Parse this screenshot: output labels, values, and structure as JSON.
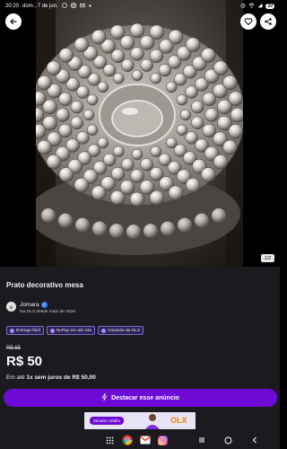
{
  "status_bar": {
    "time": "20:20",
    "date": "dom., 7 de jun.",
    "battery": "20",
    "icons": [
      "whatsapp-icon",
      "instagram-icon",
      "gmail-icon",
      "notification-dot-icon",
      "alarm-icon",
      "wifi-icon",
      "signal-icon"
    ]
  },
  "gallery": {
    "counter": "1/2",
    "subject": "glass-hobnail-plate-photo"
  },
  "header_actions": {
    "back_icon": "arrow-left-icon",
    "favorite_icon": "heart-icon",
    "share_icon": "share-icon"
  },
  "listing": {
    "title": "Prato decorativo mesa",
    "seller": {
      "name": "Jomara",
      "since": "Na OLX desde maio de 2026",
      "verified_icon": "verified-check-icon"
    },
    "badges": [
      {
        "label": "Entrega fácil",
        "icon": "box-icon"
      },
      {
        "label": "NuPay em até 24x",
        "icon": "nupay-icon"
      },
      {
        "label": "Garantia da OLX",
        "icon": "shield-icon"
      }
    ],
    "old_price": "R$ 65",
    "price": "R$ 50",
    "installments_prefix": "Em até ",
    "installments_bold": "1x sem juros de R$ 50,00"
  },
  "highlight_button": {
    "label": "Destacar esse anúncio",
    "icon": "lightning-icon"
  },
  "ad_banner": {
    "button_label": "Simular crédito",
    "logo_text": "OLX"
  },
  "navigation": {
    "apps": [
      "app-drawer-icon",
      "chrome-icon",
      "gmail-icon",
      "instagram-icon"
    ],
    "system": [
      "recents-icon",
      "home-icon",
      "back-icon"
    ]
  },
  "colors": {
    "brand_purple": "#6e0ad6",
    "olx_orange": "#f28000",
    "panel_background": "#1b1b1f"
  }
}
